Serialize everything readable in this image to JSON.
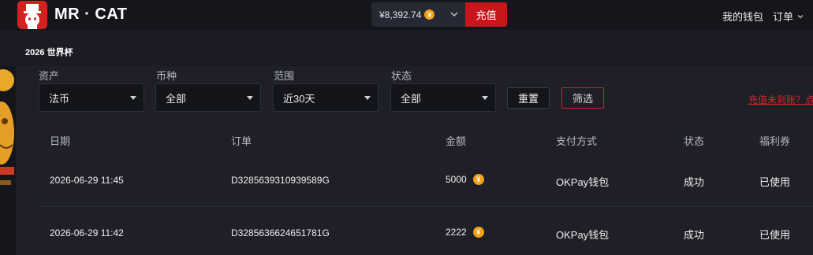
{
  "brand": {
    "name": "MR · CAT"
  },
  "header": {
    "balance": "¥8,392.74",
    "coin_symbol": "¥",
    "topup_label": "充值",
    "wallet_label": "我的钱包",
    "orders_label": "订单"
  },
  "subnav": {
    "label": "2026 世界杯"
  },
  "filters": [
    {
      "label": "资产",
      "value": "法币"
    },
    {
      "label": "币种",
      "value": "全部"
    },
    {
      "label": "范围",
      "value": "近30天"
    },
    {
      "label": "状态",
      "value": "全部"
    }
  ],
  "actions": {
    "reset": "重置",
    "filter": "筛选"
  },
  "notice_link": "充值未到账？点",
  "table": {
    "columns": [
      "日期",
      "订单",
      "金额",
      "支付方式",
      "状态",
      "福利券"
    ],
    "rows": [
      {
        "date": "2026-06-29 11:45",
        "order": "D3285639310939589G",
        "amount": "5000",
        "method": "OKPay钱包",
        "status": "成功",
        "coupon": "已使用"
      },
      {
        "date": "2026-06-29 11:42",
        "order": "D3285636624651781G",
        "amount": "2222",
        "method": "OKPay钱包",
        "status": "成功",
        "coupon": "已使用"
      }
    ]
  },
  "colors": {
    "accent": "#c8161d",
    "coin": "#f0a11a",
    "background": "#15161c",
    "panel": "#1e1f27"
  }
}
